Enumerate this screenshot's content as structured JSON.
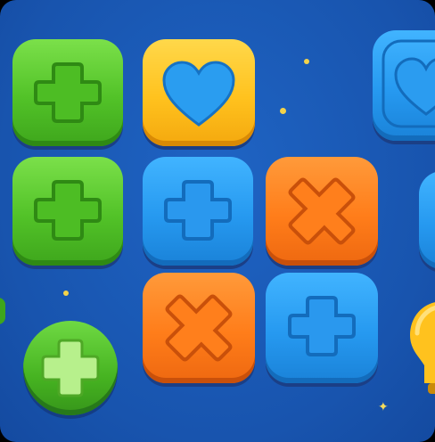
{
  "board": {
    "background_color": "#1a5ab8",
    "tiles": [
      {
        "name": "tile-green-plus-r1c1",
        "color": "green",
        "icon": "plus-icon"
      },
      {
        "name": "tile-yellow-heart-r1c2",
        "color": "yellow",
        "icon": "heart-icon"
      },
      {
        "name": "tile-blue-heart-r1c4",
        "color": "blue",
        "icon": "heart-icon"
      },
      {
        "name": "tile-green-plus-r2c1",
        "color": "green",
        "icon": "plus-icon"
      },
      {
        "name": "tile-blue-plus-r2c2",
        "color": "blue",
        "icon": "plus-icon"
      },
      {
        "name": "tile-orange-x-r2c3",
        "color": "orange",
        "icon": "x-icon"
      },
      {
        "name": "tile-orange-x-r3c2",
        "color": "orange",
        "icon": "x-icon"
      },
      {
        "name": "tile-blue-plus-r3c3",
        "color": "blue",
        "icon": "plus-icon"
      },
      {
        "name": "button-green-plus-round",
        "color": "green",
        "icon": "plus-icon"
      }
    ]
  }
}
